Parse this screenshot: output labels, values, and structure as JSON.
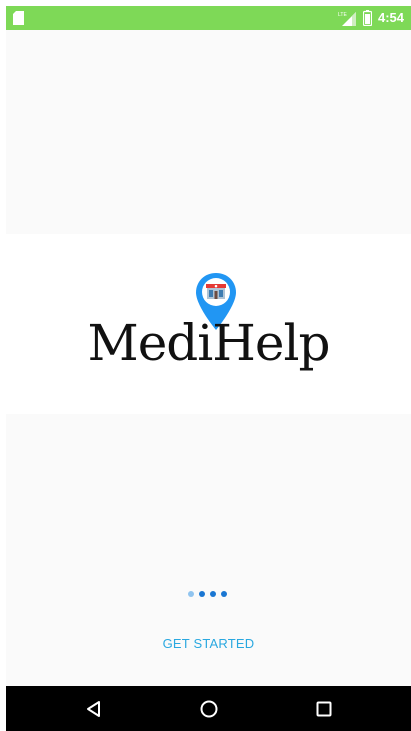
{
  "status_bar": {
    "time": "4:54",
    "network": "LTE",
    "color": "#7ed957",
    "icons": [
      "sd-card-icon",
      "signal-icon",
      "battery-icon"
    ]
  },
  "logo": {
    "text": "MediHelp",
    "icon": "map-pin-pharmacy-icon",
    "pin_color": "#2196f3"
  },
  "pager": {
    "total": 4,
    "active_index": 0
  },
  "actions": {
    "get_started_label": "GET STARTED",
    "accent": "#29a8e0"
  },
  "nav_bar": {
    "buttons": [
      "back-icon",
      "home-icon",
      "recents-icon"
    ]
  }
}
